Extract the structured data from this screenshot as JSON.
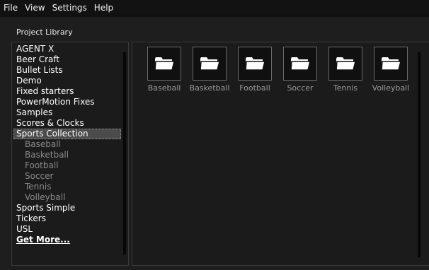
{
  "menu": [
    "File",
    "View",
    "Settings",
    "Help"
  ],
  "library_title": "Project Library",
  "tree": [
    {
      "label": "AGENT X"
    },
    {
      "label": "Beer Craft"
    },
    {
      "label": "Bullet Lists"
    },
    {
      "label": "Demo"
    },
    {
      "label": "Fixed starters"
    },
    {
      "label": "PowerMotion Fixes"
    },
    {
      "label": "Samples"
    },
    {
      "label": "Scores & Clocks"
    },
    {
      "label": "Sports Collection",
      "selected": true
    },
    {
      "label": "Baseball",
      "child": true
    },
    {
      "label": "Basketball",
      "child": true
    },
    {
      "label": "Football",
      "child": true
    },
    {
      "label": "Soccer",
      "child": true
    },
    {
      "label": "Tennis",
      "child": true
    },
    {
      "label": "Volleyball",
      "child": true
    },
    {
      "label": "Sports Simple"
    },
    {
      "label": "Tickers"
    },
    {
      "label": "USL"
    },
    {
      "label": "Get More...",
      "link": true
    }
  ],
  "folders": [
    "Baseball",
    "Basketball",
    "Football",
    "Soccer",
    "Tennis",
    "Volleyball"
  ],
  "icons": {
    "folder": "folder-icon"
  },
  "colors": {
    "background": "#1e1e1e",
    "menubar": "#121212",
    "selection": "#4b4b4b",
    "child_text": "#8a8a8a",
    "folder_label": "#9a9a9a"
  }
}
